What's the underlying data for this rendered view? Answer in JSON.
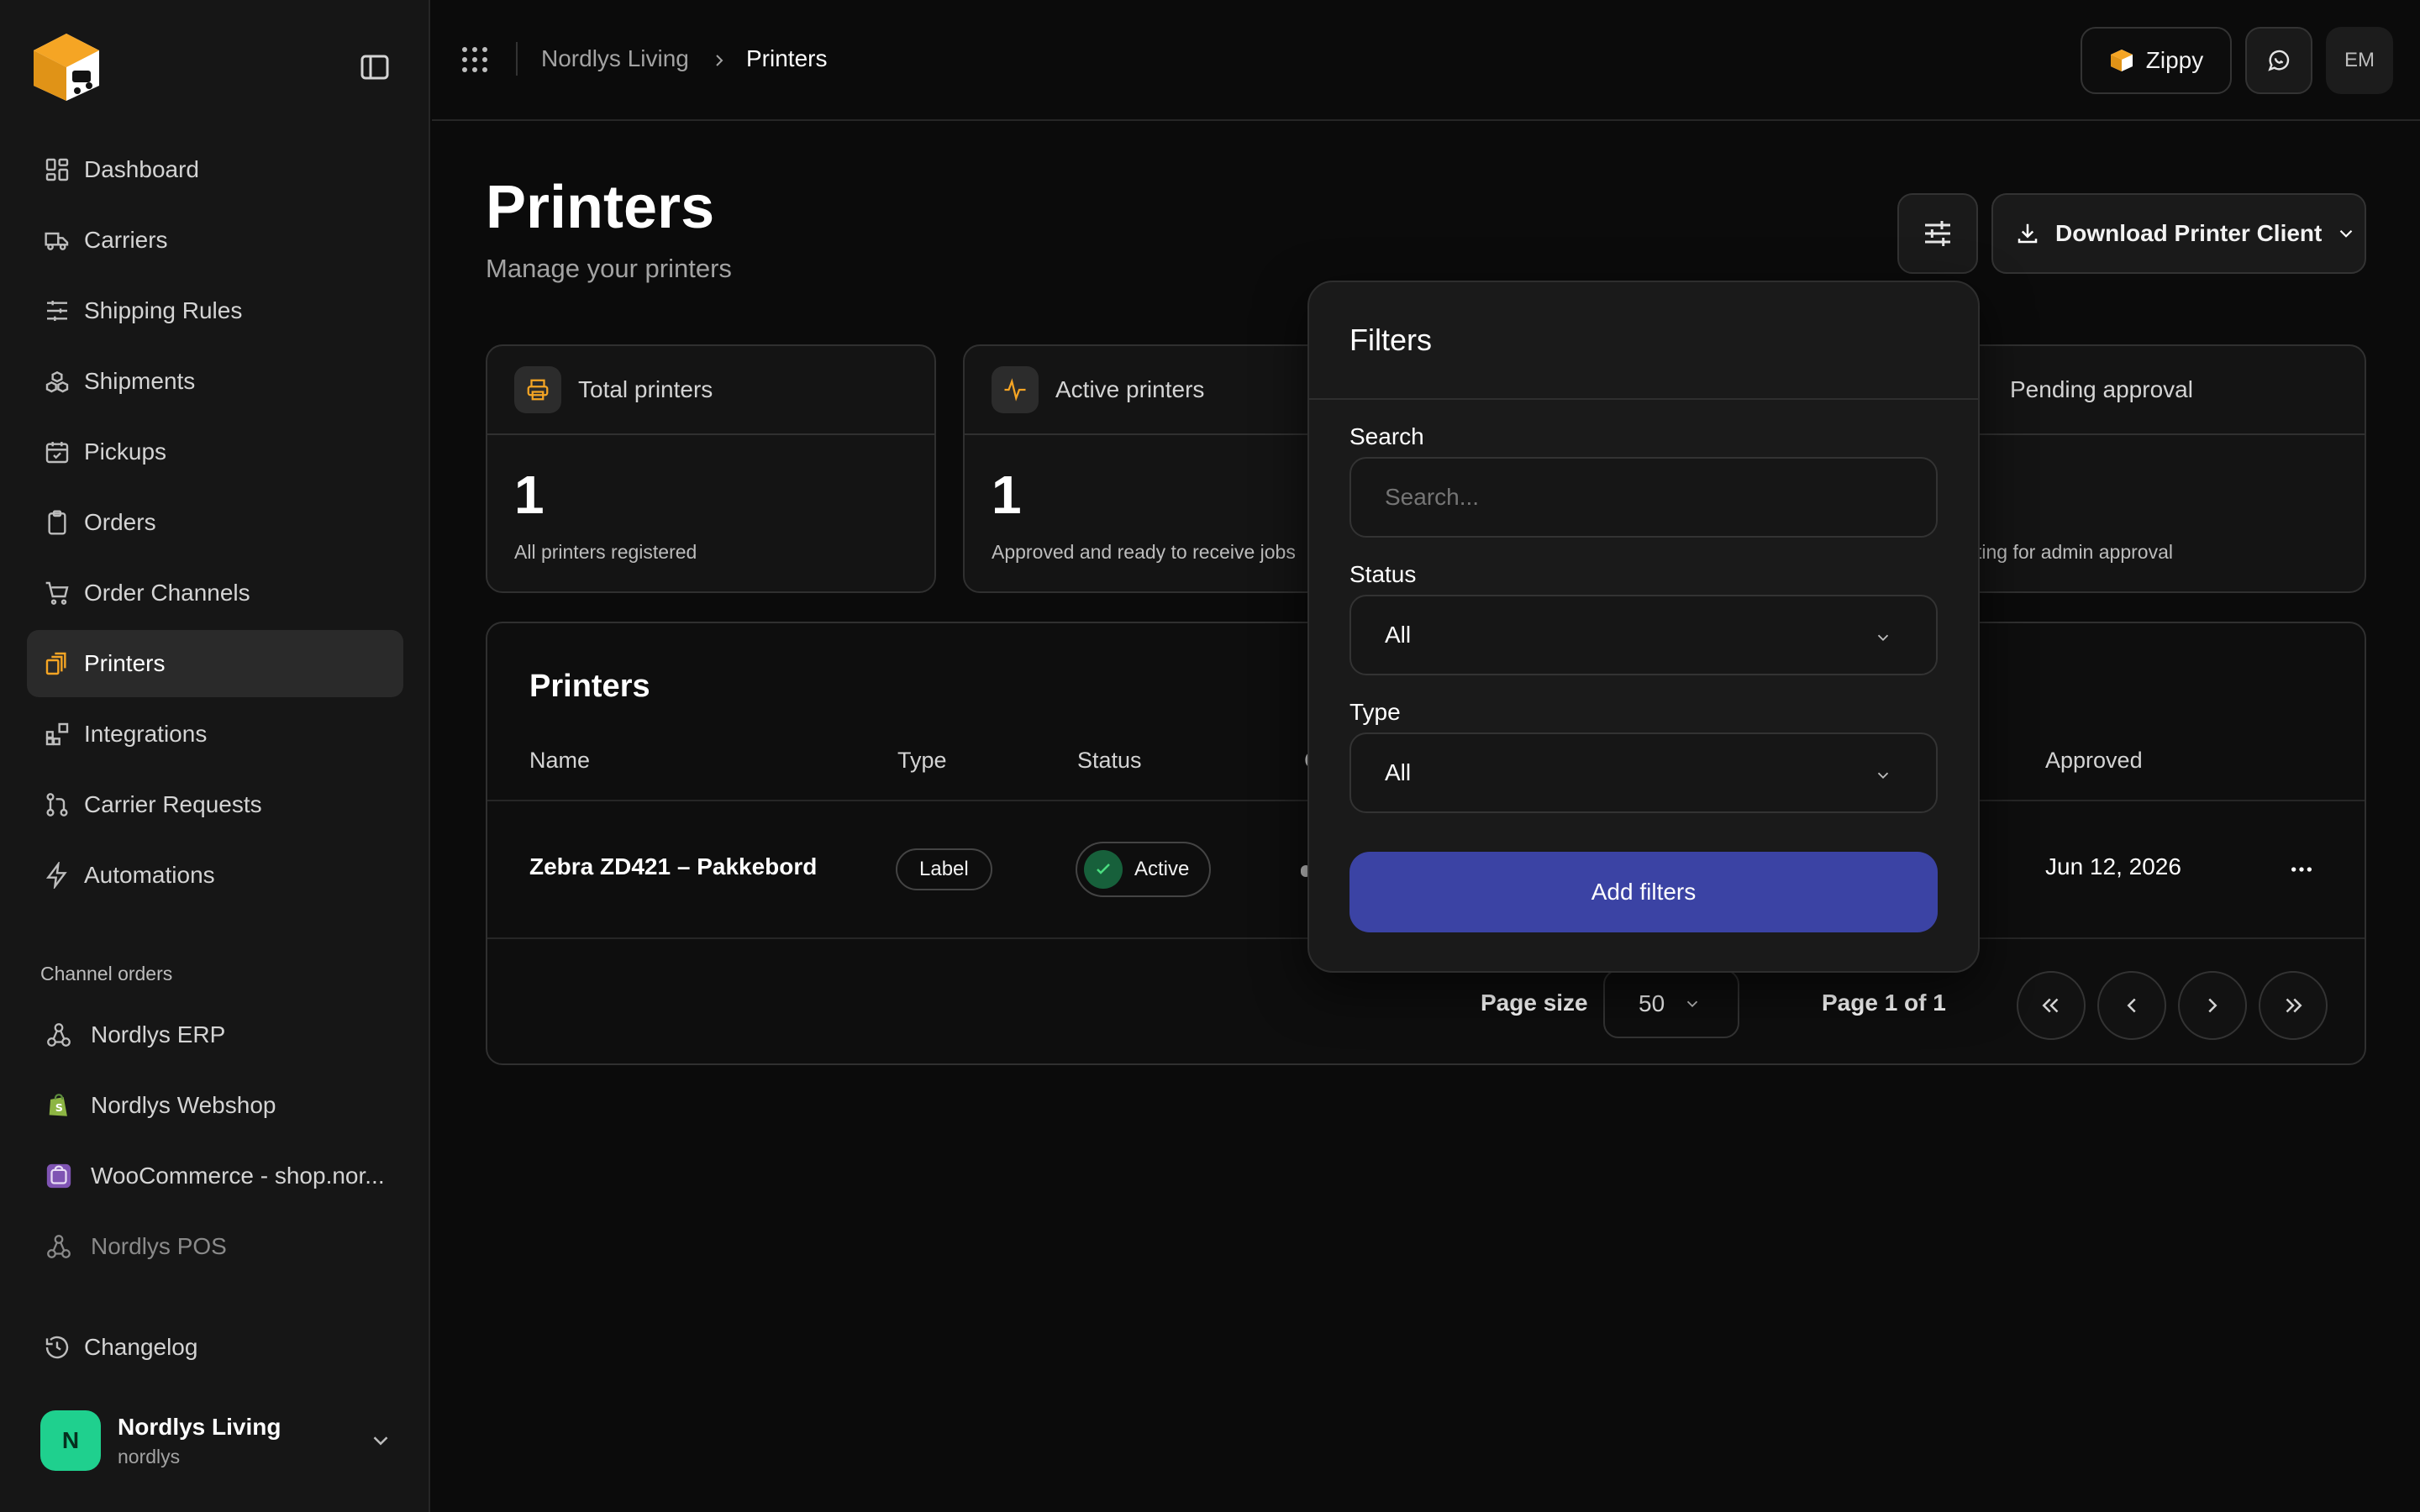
{
  "sidebar": {
    "nav": [
      {
        "label": "Dashboard",
        "icon": "dashboard-icon"
      },
      {
        "label": "Carriers",
        "icon": "truck-icon"
      },
      {
        "label": "Shipping Rules",
        "icon": "sliders-icon"
      },
      {
        "label": "Shipments",
        "icon": "boxes-icon"
      },
      {
        "label": "Pickups",
        "icon": "calendar-check-icon"
      },
      {
        "label": "Orders",
        "icon": "clipboard-icon"
      },
      {
        "label": "Order Channels",
        "icon": "cart-icon"
      },
      {
        "label": "Printers",
        "icon": "printer-icon",
        "active": true
      },
      {
        "label": "Integrations",
        "icon": "blocks-icon"
      },
      {
        "label": "Carrier Requests",
        "icon": "git-pull-icon"
      },
      {
        "label": "Automations",
        "icon": "zap-icon"
      }
    ],
    "section_label": "Channel orders",
    "channels": [
      {
        "label": "Nordlys ERP",
        "icon": "webhook-icon"
      },
      {
        "label": "Nordlys Webshop",
        "icon": "shopify-icon"
      },
      {
        "label": "WooCommerce - shop.nor...",
        "icon": "woocommerce-icon"
      },
      {
        "label": "Nordlys POS",
        "icon": "webhook-icon"
      }
    ],
    "changelog": "Changelog",
    "account": {
      "initial": "N",
      "name": "Nordlys Living",
      "slug": "nordlys"
    }
  },
  "topbar": {
    "breadcrumb": [
      "Nordlys Living",
      "Printers"
    ],
    "zippy_label": "Zippy",
    "user_initials": "EM"
  },
  "page": {
    "title": "Printers",
    "subtitle": "Manage your printers",
    "download_label": "Download Printer Client"
  },
  "stats": [
    {
      "label": "Total printers",
      "value": "1",
      "desc": "All printers registered"
    },
    {
      "label": "Active printers",
      "value": "1",
      "desc": "Approved and ready to receive jobs"
    },
    {
      "label": "Pending approval",
      "value": "",
      "desc": "ting for admin approval"
    }
  ],
  "table": {
    "title": "Printers",
    "columns": [
      "Name",
      "Type",
      "Status",
      "Approved"
    ],
    "column_partial": "C",
    "rows": [
      {
        "name": "Zebra ZD421 – Pakkebord",
        "type": "Label",
        "status": "Active",
        "approved": "Jun 12, 2026"
      }
    ],
    "page_size_label": "Page size",
    "page_size": "50",
    "page_info": "Page 1 of 1"
  },
  "filters": {
    "title": "Filters",
    "search_label": "Search",
    "search_placeholder": "Search...",
    "status_label": "Status",
    "status_value": "All",
    "type_label": "Type",
    "type_value": "All",
    "submit_label": "Add filters"
  },
  "colors": {
    "accent": "#f5a524",
    "primary_button": "#3b43a4",
    "success": "#17603b",
    "avatar": "#1fd08e"
  }
}
